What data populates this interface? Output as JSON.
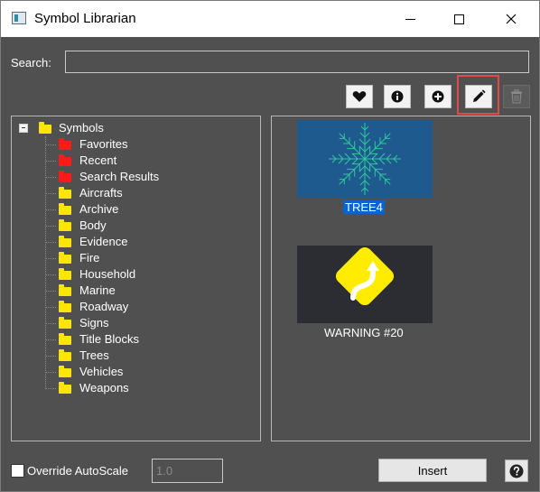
{
  "window": {
    "title": "Symbol Librarian"
  },
  "search": {
    "label": "Search:",
    "value": "",
    "placeholder": ""
  },
  "toolbar": {
    "buttons": [
      {
        "icon": "heart-icon",
        "enabled": true
      },
      {
        "icon": "info-icon",
        "enabled": true
      },
      {
        "icon": "add-icon",
        "enabled": true
      },
      {
        "icon": "pencil-icon",
        "enabled": true,
        "highlighted": true
      },
      {
        "icon": "trash-icon",
        "enabled": false
      }
    ],
    "highlight_color": "#e04a4a"
  },
  "tree": {
    "root": {
      "label": "Symbols",
      "expanded": true,
      "folder_color": "#ffe600"
    },
    "items": [
      {
        "label": "Favorites",
        "color": "#ff1a1a"
      },
      {
        "label": "Recent",
        "color": "#ff1a1a"
      },
      {
        "label": "Search Results",
        "color": "#ff1a1a"
      },
      {
        "label": "Aircrafts",
        "color": "#ffe600"
      },
      {
        "label": "Archive",
        "color": "#ffe600"
      },
      {
        "label": "Body",
        "color": "#ffe600"
      },
      {
        "label": "Evidence",
        "color": "#ffe600"
      },
      {
        "label": "Fire",
        "color": "#ffe600"
      },
      {
        "label": "Household",
        "color": "#ffe600"
      },
      {
        "label": "Marine",
        "color": "#ffe600"
      },
      {
        "label": "Roadway",
        "color": "#ffe600"
      },
      {
        "label": "Signs",
        "color": "#ffe600"
      },
      {
        "label": "Title Blocks",
        "color": "#ffe600"
      },
      {
        "label": "Trees",
        "color": "#ffe600"
      },
      {
        "label": "Vehicles",
        "color": "#ffe600"
      },
      {
        "label": "Weapons",
        "color": "#ffe600"
      }
    ]
  },
  "symbols": [
    {
      "label": "TREE4",
      "selected": true,
      "thumb_bg": "#1f5a8f",
      "icon": "tree-symbol-icon"
    },
    {
      "label": "WARNING #20",
      "selected": false,
      "thumb_bg": "#2b2d33",
      "icon": "curve-warning-sign-icon"
    }
  ],
  "bottom": {
    "override_label": "Override AutoScale",
    "override_checked": false,
    "scale_value": "1.0",
    "insert_label": "Insert",
    "help_icon": "help-icon"
  },
  "colors": {
    "background": "#505050",
    "selection": "#0a64d0"
  }
}
